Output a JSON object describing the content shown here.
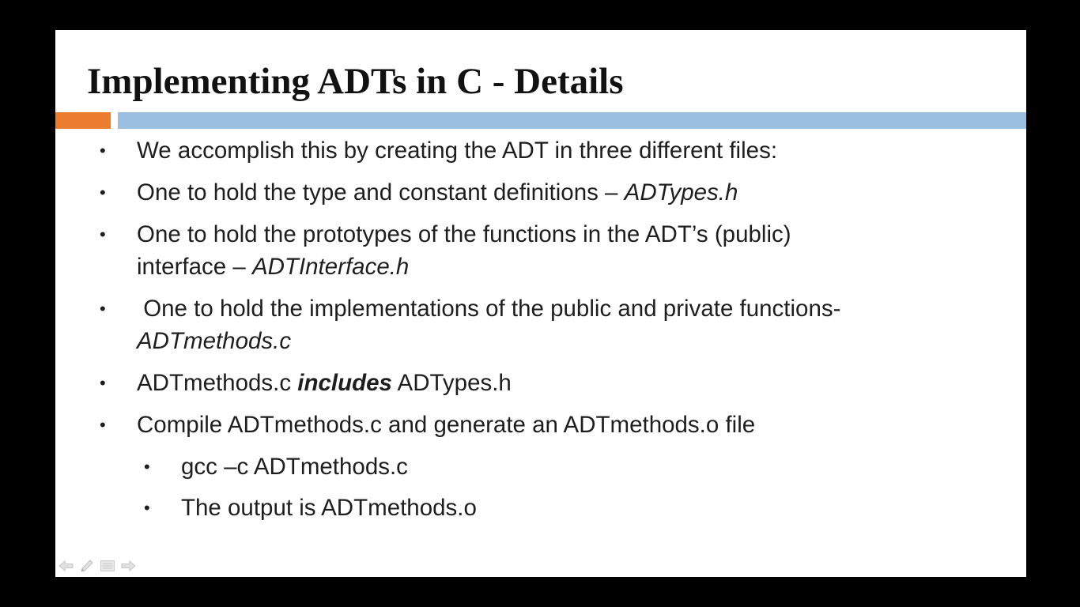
{
  "slide": {
    "title": "Implementing ADTs in C - Details",
    "bullets": [
      {
        "text": "We accomplish this by creating the ADT in three different files:"
      },
      {
        "text": "One to hold the type and constant definitions – ",
        "emphasis": "ADTypes.h"
      },
      {
        "line1": "One to hold the prototypes of the functions in the ADT’s (public)",
        "line2": "interface – ",
        "emphasis": "ADTInterface.h"
      },
      {
        "line1": " One to hold the implementations of the public and private functions-",
        "emphasis": "ADTmethods.c"
      },
      {
        "before": "ADTmethods.c ",
        "strong_emphasis": "includes",
        "after": " ADTypes.h"
      },
      {
        "text": "Compile ADTmethods.c and generate an ADTmethods.o file"
      }
    ],
    "sub_bullets": [
      {
        "text": "gcc –c ADTmethods.c"
      },
      {
        "text": "The output is ADTmethods.o"
      }
    ],
    "bullet_char": "•"
  },
  "navigation": {
    "icons": [
      "arrow-left-icon",
      "pen-icon",
      "menu-icon",
      "arrow-right-icon"
    ]
  },
  "colors": {
    "background": "#000000",
    "slide": "#ffffff",
    "accent_orange": "#ec7c30",
    "accent_blue": "#9bc0df",
    "text": "#1e1e1e"
  }
}
